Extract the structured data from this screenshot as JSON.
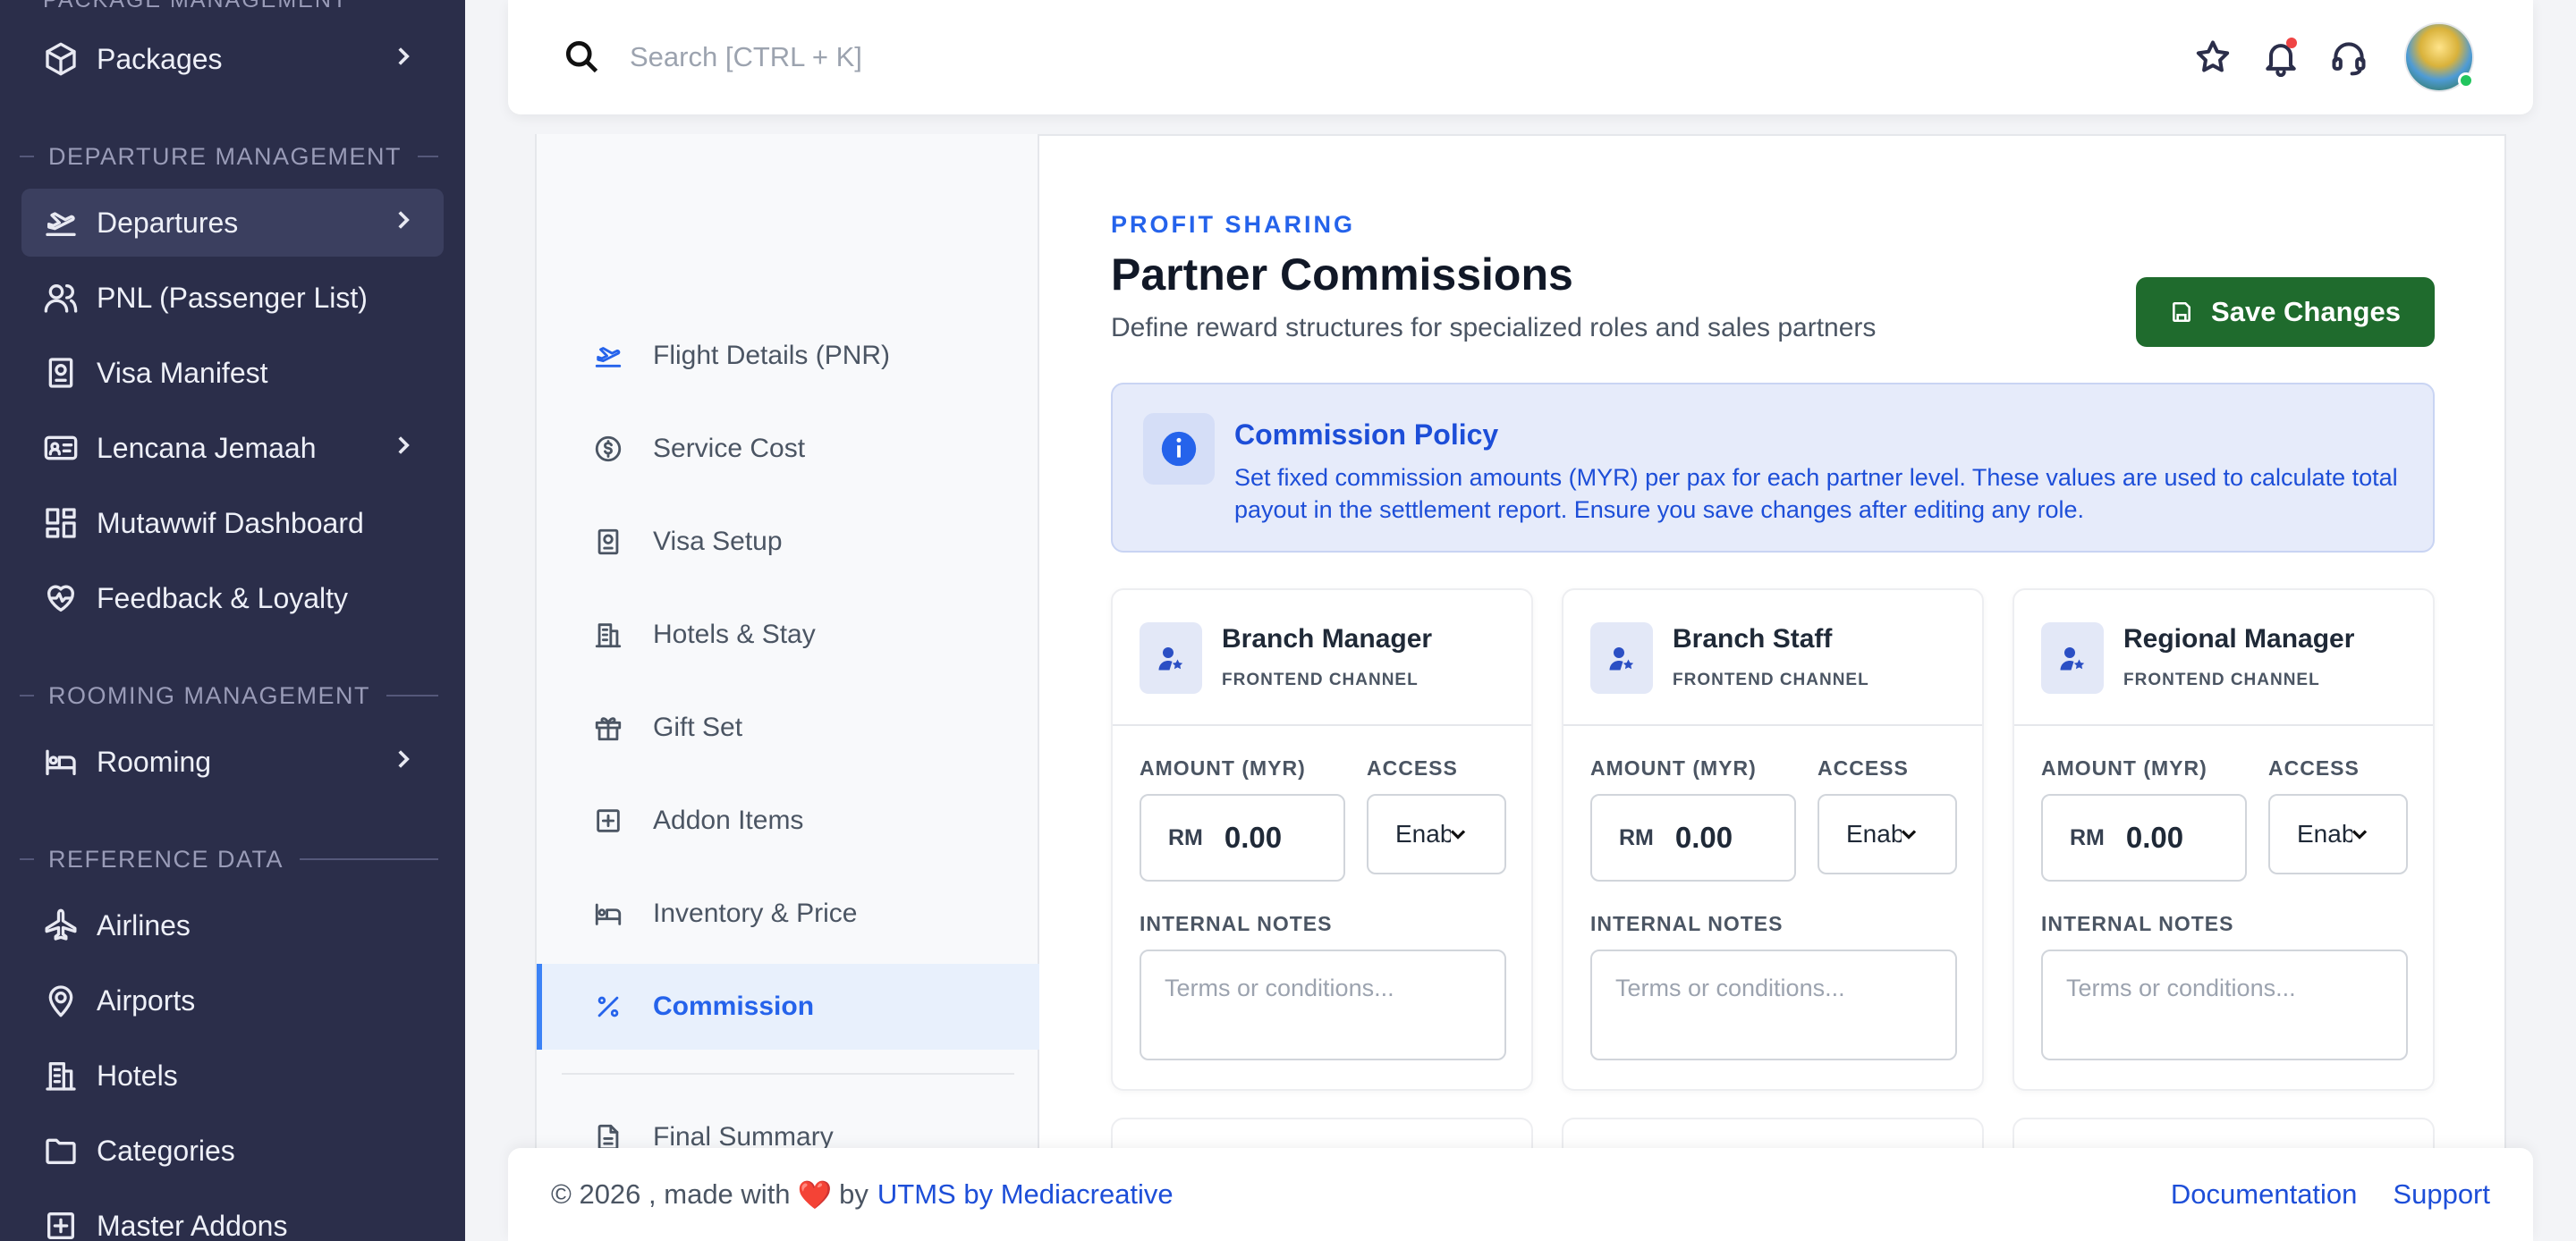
{
  "sidebar": {
    "top_cut": "PACKAGE MANAGEMENT",
    "packages": "Packages",
    "section_departure": "Departure Management",
    "departures": "Departures",
    "pnl": "PNL (Passenger List)",
    "visa_manifest": "Visa Manifest",
    "lencana": "Lencana Jemaah",
    "mutawwif": "Mutawwif Dashboard",
    "feedback": "Feedback & Loyalty",
    "section_rooming": "Rooming Management",
    "rooming": "Rooming",
    "section_reference": "Reference Data",
    "airlines": "Airlines",
    "airports": "Airports",
    "hotels": "Hotels",
    "categories": "Categories",
    "master_addons": "Master Addons"
  },
  "topbar": {
    "search_placeholder": "Search [CTRL + K]"
  },
  "steps": [
    {
      "label": "Flight Details (PNR)"
    },
    {
      "label": "Service Cost"
    },
    {
      "label": "Visa Setup"
    },
    {
      "label": "Hotels & Stay"
    },
    {
      "label": "Gift Set"
    },
    {
      "label": "Addon Items"
    },
    {
      "label": "Inventory & Price"
    },
    {
      "label": "Commission"
    },
    {
      "label": "Final Summary"
    }
  ],
  "content": {
    "eyebrow": "PROFIT SHARING",
    "title": "Partner Commissions",
    "subtitle": "Define reward structures for specialized roles and sales partners",
    "save_label": "Save Changes",
    "policy_title": "Commission Policy",
    "policy_body": "Set fixed commission amounts (MYR) per pax for each partner level. These values are used to calculate total payout in the settlement report. Ensure you save changes after editing any role."
  },
  "labels": {
    "amount": "AMOUNT (MYR)",
    "access": "ACCESS",
    "notes": "INTERNAL NOTES",
    "currency": "RM",
    "notes_placeholder": "Terms or conditions..."
  },
  "roles": [
    {
      "name": "Branch Manager",
      "channel": "FRONTEND CHANNEL",
      "amount": "0.00",
      "access": "Enabled"
    },
    {
      "name": "Branch Staff",
      "channel": "FRONTEND CHANNEL",
      "amount": "0.00",
      "access": "Enabled"
    },
    {
      "name": "Regional Manager",
      "channel": "FRONTEND CHANNEL",
      "amount": "0.00",
      "access": "Enabled"
    }
  ],
  "footer": {
    "copyright": "© 2026 , made with",
    "heart": "❤️",
    "by": "by",
    "brand": "UTMS by Mediacreative",
    "documentation": "Documentation",
    "support": "Support"
  },
  "colors": {
    "sidebar_bg": "#2b2e4a",
    "accent_blue": "#2563eb",
    "save_green": "#1f6b2d",
    "policy_bg": "#e6ebfa"
  }
}
